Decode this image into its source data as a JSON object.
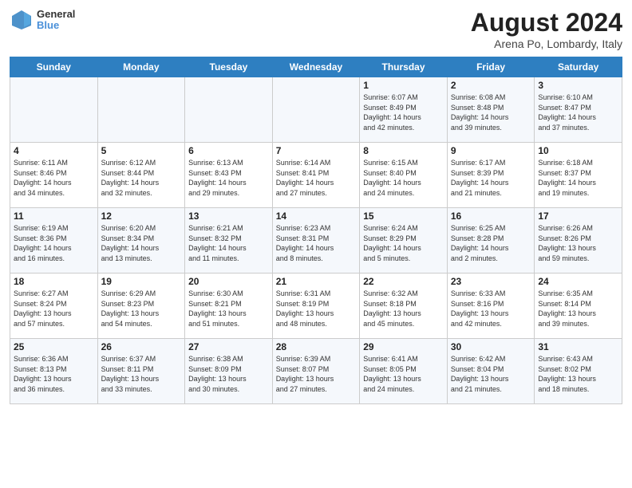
{
  "logo": {
    "line1": "General",
    "line2": "Blue"
  },
  "title": "August 2024",
  "subtitle": "Arena Po, Lombardy, Italy",
  "days_of_week": [
    "Sunday",
    "Monday",
    "Tuesday",
    "Wednesday",
    "Thursday",
    "Friday",
    "Saturday"
  ],
  "weeks": [
    [
      {
        "day": "",
        "info": ""
      },
      {
        "day": "",
        "info": ""
      },
      {
        "day": "",
        "info": ""
      },
      {
        "day": "",
        "info": ""
      },
      {
        "day": "1",
        "info": "Sunrise: 6:07 AM\nSunset: 8:49 PM\nDaylight: 14 hours\nand 42 minutes."
      },
      {
        "day": "2",
        "info": "Sunrise: 6:08 AM\nSunset: 8:48 PM\nDaylight: 14 hours\nand 39 minutes."
      },
      {
        "day": "3",
        "info": "Sunrise: 6:10 AM\nSunset: 8:47 PM\nDaylight: 14 hours\nand 37 minutes."
      }
    ],
    [
      {
        "day": "4",
        "info": "Sunrise: 6:11 AM\nSunset: 8:46 PM\nDaylight: 14 hours\nand 34 minutes."
      },
      {
        "day": "5",
        "info": "Sunrise: 6:12 AM\nSunset: 8:44 PM\nDaylight: 14 hours\nand 32 minutes."
      },
      {
        "day": "6",
        "info": "Sunrise: 6:13 AM\nSunset: 8:43 PM\nDaylight: 14 hours\nand 29 minutes."
      },
      {
        "day": "7",
        "info": "Sunrise: 6:14 AM\nSunset: 8:41 PM\nDaylight: 14 hours\nand 27 minutes."
      },
      {
        "day": "8",
        "info": "Sunrise: 6:15 AM\nSunset: 8:40 PM\nDaylight: 14 hours\nand 24 minutes."
      },
      {
        "day": "9",
        "info": "Sunrise: 6:17 AM\nSunset: 8:39 PM\nDaylight: 14 hours\nand 21 minutes."
      },
      {
        "day": "10",
        "info": "Sunrise: 6:18 AM\nSunset: 8:37 PM\nDaylight: 14 hours\nand 19 minutes."
      }
    ],
    [
      {
        "day": "11",
        "info": "Sunrise: 6:19 AM\nSunset: 8:36 PM\nDaylight: 14 hours\nand 16 minutes."
      },
      {
        "day": "12",
        "info": "Sunrise: 6:20 AM\nSunset: 8:34 PM\nDaylight: 14 hours\nand 13 minutes."
      },
      {
        "day": "13",
        "info": "Sunrise: 6:21 AM\nSunset: 8:32 PM\nDaylight: 14 hours\nand 11 minutes."
      },
      {
        "day": "14",
        "info": "Sunrise: 6:23 AM\nSunset: 8:31 PM\nDaylight: 14 hours\nand 8 minutes."
      },
      {
        "day": "15",
        "info": "Sunrise: 6:24 AM\nSunset: 8:29 PM\nDaylight: 14 hours\nand 5 minutes."
      },
      {
        "day": "16",
        "info": "Sunrise: 6:25 AM\nSunset: 8:28 PM\nDaylight: 14 hours\nand 2 minutes."
      },
      {
        "day": "17",
        "info": "Sunrise: 6:26 AM\nSunset: 8:26 PM\nDaylight: 13 hours\nand 59 minutes."
      }
    ],
    [
      {
        "day": "18",
        "info": "Sunrise: 6:27 AM\nSunset: 8:24 PM\nDaylight: 13 hours\nand 57 minutes."
      },
      {
        "day": "19",
        "info": "Sunrise: 6:29 AM\nSunset: 8:23 PM\nDaylight: 13 hours\nand 54 minutes."
      },
      {
        "day": "20",
        "info": "Sunrise: 6:30 AM\nSunset: 8:21 PM\nDaylight: 13 hours\nand 51 minutes."
      },
      {
        "day": "21",
        "info": "Sunrise: 6:31 AM\nSunset: 8:19 PM\nDaylight: 13 hours\nand 48 minutes."
      },
      {
        "day": "22",
        "info": "Sunrise: 6:32 AM\nSunset: 8:18 PM\nDaylight: 13 hours\nand 45 minutes."
      },
      {
        "day": "23",
        "info": "Sunrise: 6:33 AM\nSunset: 8:16 PM\nDaylight: 13 hours\nand 42 minutes."
      },
      {
        "day": "24",
        "info": "Sunrise: 6:35 AM\nSunset: 8:14 PM\nDaylight: 13 hours\nand 39 minutes."
      }
    ],
    [
      {
        "day": "25",
        "info": "Sunrise: 6:36 AM\nSunset: 8:13 PM\nDaylight: 13 hours\nand 36 minutes."
      },
      {
        "day": "26",
        "info": "Sunrise: 6:37 AM\nSunset: 8:11 PM\nDaylight: 13 hours\nand 33 minutes."
      },
      {
        "day": "27",
        "info": "Sunrise: 6:38 AM\nSunset: 8:09 PM\nDaylight: 13 hours\nand 30 minutes."
      },
      {
        "day": "28",
        "info": "Sunrise: 6:39 AM\nSunset: 8:07 PM\nDaylight: 13 hours\nand 27 minutes."
      },
      {
        "day": "29",
        "info": "Sunrise: 6:41 AM\nSunset: 8:05 PM\nDaylight: 13 hours\nand 24 minutes."
      },
      {
        "day": "30",
        "info": "Sunrise: 6:42 AM\nSunset: 8:04 PM\nDaylight: 13 hours\nand 21 minutes."
      },
      {
        "day": "31",
        "info": "Sunrise: 6:43 AM\nSunset: 8:02 PM\nDaylight: 13 hours\nand 18 minutes."
      }
    ]
  ]
}
